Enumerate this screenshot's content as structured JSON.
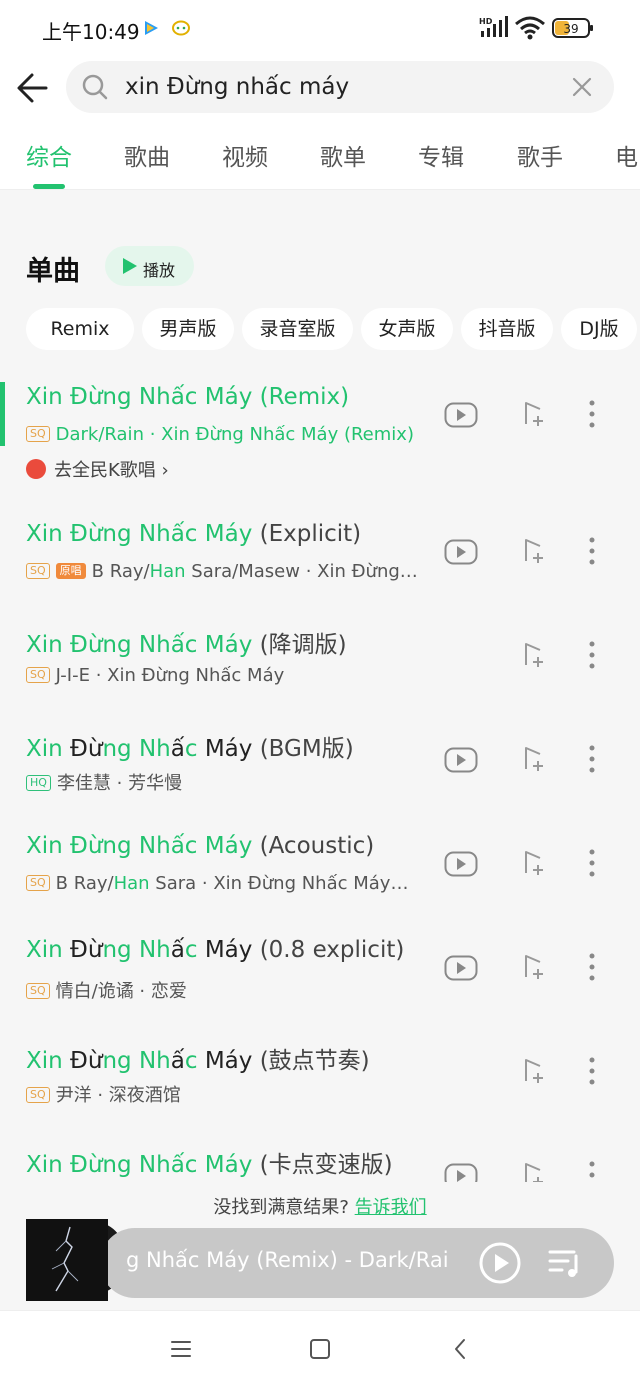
{
  "status_bar": {
    "time": "上午10:49",
    "network_label": "HD",
    "battery": "39",
    "icons": [
      "play-triangle-app-icon",
      "chat-app-icon",
      "signal-icon",
      "wifi-icon",
      "battery-icon"
    ]
  },
  "search": {
    "query": "xin Đừng nhấc máy",
    "icons": [
      "back-arrow-icon",
      "search-icon",
      "clear-icon"
    ]
  },
  "tabs": [
    "综合",
    "歌曲",
    "视频",
    "歌单",
    "专辑",
    "歌手",
    "电"
  ],
  "active_tab": "综合",
  "section": {
    "title": "单曲",
    "play_all": "播放"
  },
  "filter_chips": [
    "Remix",
    "男声版",
    "录音室版",
    "女声版",
    "抖音版",
    "DJ版"
  ],
  "songs": [
    {
      "title_main": "Xin Đừng Nhấc Máy",
      "title_version": "(Remix)",
      "quality": "SQ",
      "subtitle": "Dark/Rain · Xin Đừng Nhấc Máy (Remix)",
      "extra_link": "去全民K歌唱 ›",
      "playing": true,
      "has_mv": true
    },
    {
      "title_main": "Xin Đừng Nhấc Máy",
      "title_version": "(Explicit)",
      "quality": "SQ",
      "original_badge": "原唱",
      "subtitle_pre": "B Ray/",
      "subtitle_hl": "Han",
      "subtitle_post": " Sara/Masew · Xin Đừng…",
      "has_mv": true
    },
    {
      "title_main": "Xin Đừng Nhấc Máy",
      "title_version": "(降调版)",
      "quality": "SQ",
      "subtitle": "J-I-E · Xin Đừng Nhấc Máy",
      "has_mv": false
    },
    {
      "title_parts": [
        "Xin",
        "Đừ",
        "ng",
        "Nh",
        "ấ",
        "c",
        "Máy"
      ],
      "title_version": "(BGM版)",
      "quality": "HQ",
      "subtitle": "李佳慧 · 芳华慢",
      "has_mv": true
    },
    {
      "title_main": "Xin Đừng Nhấc Máy",
      "title_version": "(Acoustic)",
      "quality": "SQ",
      "subtitle_pre": "B Ray/",
      "subtitle_hl": "Han",
      "subtitle_post": " Sara · Xin Đừng Nhấc Máy…",
      "has_mv": true
    },
    {
      "title_parts": [
        "Xin",
        "Đừ",
        "ng",
        "Nh",
        "ấ",
        "c",
        "Máy"
      ],
      "title_version": "(0.8 explicit)",
      "quality": "SQ",
      "subtitle": "情白/诡谲 · 恋爱",
      "has_mv": true
    },
    {
      "title_parts": [
        "Xin",
        "Đừ",
        "ng",
        "Nh",
        "ấ",
        "c",
        "Máy"
      ],
      "title_version": "(鼓点节奏)",
      "quality": "SQ",
      "subtitle": "尹洋 · 深夜酒馆",
      "has_mv": false
    },
    {
      "title_main": "Xin Đừng Nhấc Máy",
      "title_version": "(卡点变速版)",
      "has_mv": true
    }
  ],
  "feedback": {
    "text": "没找到满意结果?",
    "link": "告诉我们"
  },
  "now_playing": {
    "text": "g Nhấc Máy (Remix) - Dark/Rain",
    "icons": [
      "album-cover",
      "play-icon",
      "playlist-icon"
    ]
  },
  "nav_bar": {
    "icons": [
      "menu-icon",
      "home-icon",
      "back-icon"
    ]
  },
  "colors": {
    "accent": "#22c26f",
    "sq_badge": "#e5a34a",
    "original_badge": "#f08a3c",
    "background": "#f6f6f6"
  }
}
